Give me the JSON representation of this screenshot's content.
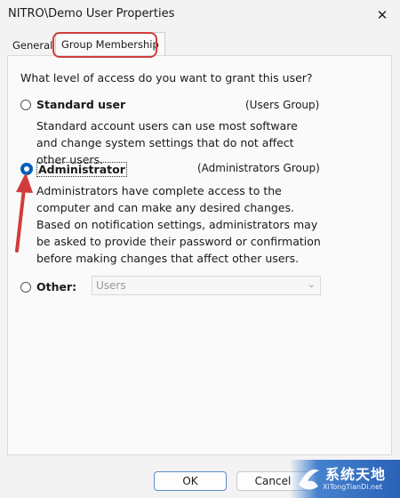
{
  "window": {
    "title": "NITRO\\Demo User Properties",
    "close_glyph": "✕"
  },
  "tabs": [
    {
      "label": "General",
      "selected": false
    },
    {
      "label": "Group Membership",
      "selected": true
    }
  ],
  "question": "What level of access do you want to grant this user?",
  "options": {
    "standard": {
      "label": "Standard user",
      "group": "(Users Group)",
      "checked": false,
      "description": "Standard account users can use most software and change system settings that do not affect other users."
    },
    "administrator": {
      "label": "Administrator",
      "group": "(Administrators Group)",
      "checked": true,
      "description": "Administrators have complete access to the computer and can make any desired changes. Based on notification settings, administrators may be asked to provide their password or confirmation before making changes that affect other users."
    },
    "other": {
      "label": "Other:",
      "checked": false,
      "select_value": "Users"
    }
  },
  "buttons": {
    "ok": "OK",
    "cancel": "Cancel"
  },
  "watermark": {
    "main": "系统天地",
    "sub": "XiTongTianDi.net"
  },
  "colors": {
    "accent": "#005fb8",
    "annotation": "#d33c3c"
  }
}
